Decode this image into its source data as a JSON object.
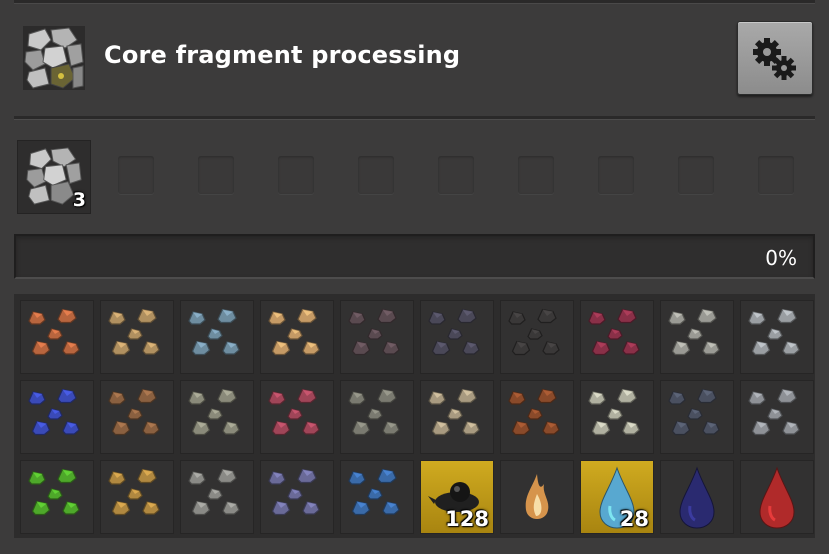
{
  "header": {
    "title": "Core fragment processing",
    "recipe_icon": "core-fragment-icon",
    "settings_icon": "gears-icon"
  },
  "inputs": {
    "main": {
      "icon": "core-fragment-icon",
      "count": "3"
    },
    "empty_slots": 9
  },
  "progress": {
    "value": 0,
    "label": "0%",
    "color": "#f5a000"
  },
  "outputs": [
    {
      "icon": "copper-ore-icon",
      "color": "#b8653e",
      "count": ""
    },
    {
      "icon": "tin-ore-icon",
      "color": "#b09060",
      "count": ""
    },
    {
      "icon": "nickel-ore-icon",
      "color": "#6e8da0",
      "count": ""
    },
    {
      "icon": "gold-ore-icon",
      "color": "#c59a65",
      "count": ""
    },
    {
      "icon": "manganese-ore-icon",
      "color": "#5a4a50",
      "count": ""
    },
    {
      "icon": "graphite-icon",
      "color": "#4a4858",
      "count": ""
    },
    {
      "icon": "coal-icon",
      "color": "#3a3838",
      "count": ""
    },
    {
      "icon": "ruby-ore-icon",
      "color": "#8a3048",
      "count": ""
    },
    {
      "icon": "stone-icon",
      "color": "#9a9a94",
      "count": ""
    },
    {
      "icon": "iron-ore-icon",
      "color": "#9a9ea2",
      "count": ""
    },
    {
      "icon": "cobalt-ore-icon",
      "color": "#3a4ab8",
      "count": ""
    },
    {
      "icon": "bauxite-ore-icon",
      "color": "#8a6040",
      "count": ""
    },
    {
      "icon": "zinc-ore-icon",
      "color": "#8a8a7a",
      "count": ""
    },
    {
      "icon": "rutile-ore-icon",
      "color": "#a04558",
      "count": ""
    },
    {
      "icon": "lead-ore-icon",
      "color": "#7a7a70",
      "count": ""
    },
    {
      "icon": "silver-ore-icon",
      "color": "#a89a80",
      "count": ""
    },
    {
      "icon": "tungsten-ore-icon",
      "color": "#8a4a2a",
      "count": ""
    },
    {
      "icon": "quartz-icon",
      "color": "#b0b0a0",
      "count": ""
    },
    {
      "icon": "mixed-gems-icon",
      "color": "#4a5060",
      "count": ""
    },
    {
      "icon": "sand-icon",
      "color": "#8e9196",
      "count": ""
    },
    {
      "icon": "green-ore-icon",
      "color": "#4ea82a",
      "count": ""
    },
    {
      "icon": "sulfur-ore-icon",
      "color": "#b08840",
      "count": ""
    },
    {
      "icon": "limestone-icon",
      "color": "#8a8a86",
      "count": ""
    },
    {
      "icon": "purple-ore-icon",
      "color": "#6a6a98",
      "count": ""
    },
    {
      "icon": "blue-ore-icon",
      "color": "#3a6aa8",
      "count": ""
    },
    {
      "icon": "tar-icon",
      "color": "#202020",
      "count": "128",
      "highlight": true
    },
    {
      "icon": "flame-icon",
      "color": "#e8a050",
      "count": ""
    },
    {
      "icon": "water-drop-icon",
      "color": "#58a8d0",
      "count": "28",
      "highlight": true
    },
    {
      "icon": "crude-oil-drop-icon",
      "color": "#2a2a70",
      "count": ""
    },
    {
      "icon": "lava-drop-icon",
      "color": "#b02a2a",
      "count": ""
    }
  ]
}
